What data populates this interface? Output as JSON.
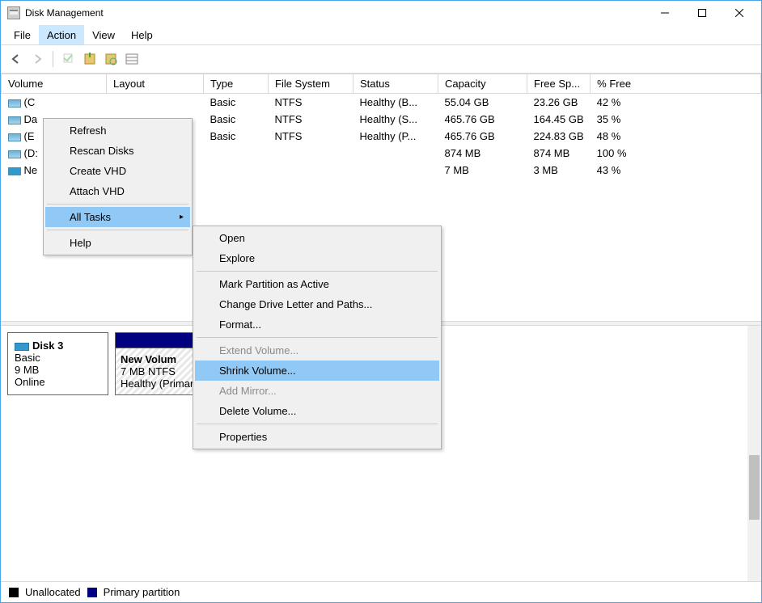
{
  "title": "Disk Management",
  "menubar": [
    "File",
    "Action",
    "View",
    "Help"
  ],
  "active_menu_index": 1,
  "action_menu": {
    "items": [
      {
        "label": "Refresh"
      },
      {
        "label": "Rescan Disks"
      },
      {
        "label": "Create VHD"
      },
      {
        "label": "Attach VHD"
      },
      {
        "sep": true
      },
      {
        "label": "All Tasks",
        "highlight": true,
        "has_sub": true
      },
      {
        "sep": true
      },
      {
        "label": "Help"
      }
    ]
  },
  "submenu": {
    "items": [
      {
        "label": "Open"
      },
      {
        "label": "Explore"
      },
      {
        "sep": true
      },
      {
        "label": "Mark Partition as Active"
      },
      {
        "label": "Change Drive Letter and Paths..."
      },
      {
        "label": "Format..."
      },
      {
        "sep": true
      },
      {
        "label": "Extend Volume...",
        "disabled": true
      },
      {
        "label": "Shrink Volume...",
        "highlight": true
      },
      {
        "label": "Add Mirror...",
        "disabled": true
      },
      {
        "label": "Delete Volume..."
      },
      {
        "sep": true
      },
      {
        "label": "Properties"
      }
    ]
  },
  "columns": [
    "Volume",
    "Layout",
    "Type",
    "File System",
    "Status",
    "Capacity",
    "Free Sp...",
    "% Free"
  ],
  "rows": [
    {
      "vol": "(C",
      "type": "Basic",
      "fs": "NTFS",
      "status": "Healthy (B...",
      "cap": "55.04 GB",
      "free": "23.26 GB",
      "pct": "42 %"
    },
    {
      "vol": "Da",
      "type": "Basic",
      "fs": "NTFS",
      "status": "Healthy (S...",
      "cap": "465.76 GB",
      "free": "164.45 GB",
      "pct": "35 %"
    },
    {
      "vol": "(E",
      "type": "Basic",
      "fs": "NTFS",
      "status": "Healthy (P...",
      "cap": "465.76 GB",
      "free": "224.83 GB",
      "pct": "48 %"
    },
    {
      "vol": "(D:",
      "type": "",
      "fs": "",
      "status": "",
      "cap": "874 MB",
      "free": "874 MB",
      "pct": "100 %"
    },
    {
      "vol": "Ne",
      "type": "",
      "fs": "",
      "status": "",
      "cap": "7 MB",
      "free": "3 MB",
      "pct": "43 %"
    }
  ],
  "disk": {
    "name": "Disk 3",
    "type": "Basic",
    "size": "9 MB",
    "status": "Online"
  },
  "partition": {
    "name": "New Volum",
    "detail": "7 MB NTFS",
    "status": "Healthy (Primary P"
  },
  "legend": {
    "unalloc": "Unallocated",
    "primary": "Primary partition"
  }
}
